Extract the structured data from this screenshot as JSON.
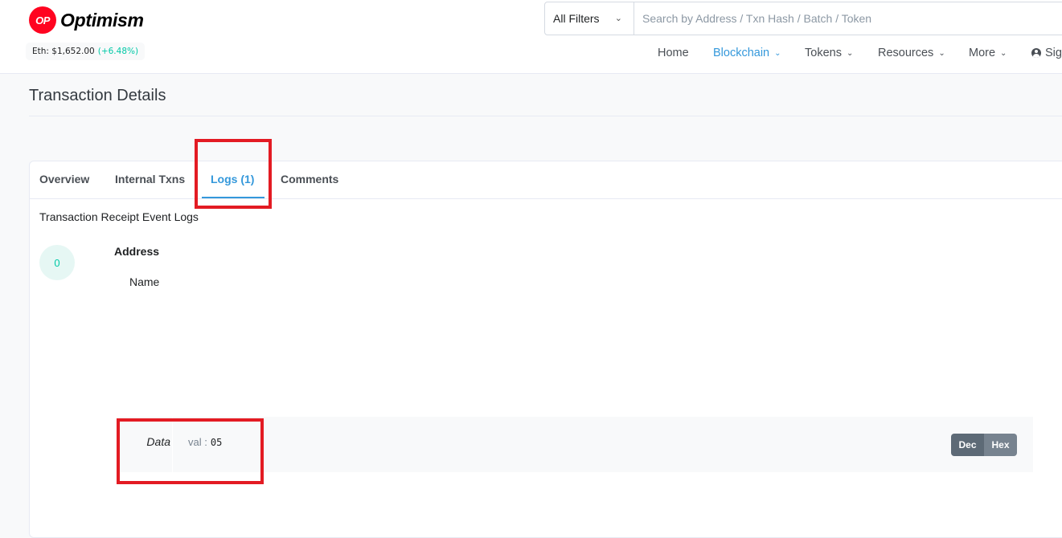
{
  "brand": {
    "badge": "OP",
    "name": "Optimism",
    "color": "#ff0420"
  },
  "price": {
    "label": "Eth: $1,652.00",
    "change": "(+6.48%)",
    "change_color": "#00c9a7"
  },
  "search": {
    "filter_label": "All Filters",
    "placeholder": "Search by Address / Txn Hash / Batch / Token"
  },
  "nav": {
    "items": [
      {
        "label": "Home",
        "has_caret": false
      },
      {
        "label": "Blockchain",
        "has_caret": true,
        "active": true
      },
      {
        "label": "Tokens",
        "has_caret": true
      },
      {
        "label": "Resources",
        "has_caret": true
      },
      {
        "label": "More",
        "has_caret": true
      },
      {
        "label": "Sig",
        "icon": "user-circle-icon"
      }
    ]
  },
  "page": {
    "title": "Transaction Details"
  },
  "tabs": [
    {
      "label": "Overview"
    },
    {
      "label": "Internal Txns"
    },
    {
      "label": "Logs (1)",
      "active": true
    },
    {
      "label": "Comments"
    }
  ],
  "logs": {
    "subheading": "Transaction Receipt Event Logs",
    "entry": {
      "index": "0",
      "address_label": "Address",
      "name_label": "Name",
      "data_label": "Data",
      "data_key": "val :",
      "data_value": "05",
      "toggle": {
        "dec": "Dec",
        "hex": "Hex"
      }
    }
  },
  "colors": {
    "accent": "#3498db",
    "highlight": "#e31b23"
  }
}
